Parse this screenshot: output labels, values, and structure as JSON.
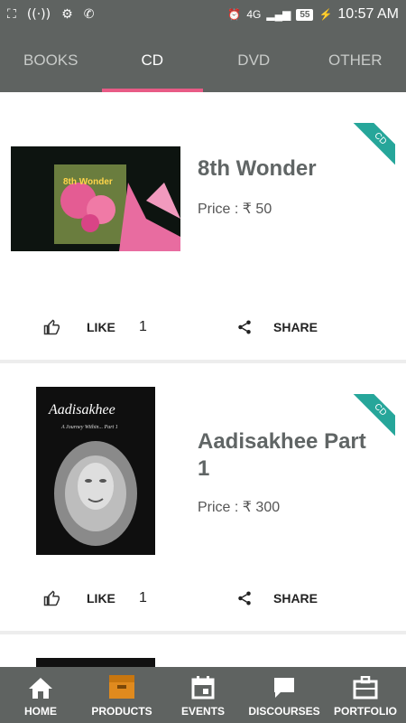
{
  "status_bar": {
    "time": "10:57 AM",
    "battery": "55",
    "network": "4G"
  },
  "tabs": [
    {
      "label": "BOOKS"
    },
    {
      "label": "CD"
    },
    {
      "label": "DVD"
    },
    {
      "label": "OTHER"
    }
  ],
  "active_tab": "CD",
  "items": [
    {
      "title": "8th Wonder",
      "price": "Price : ₹ 50",
      "badge": "CD",
      "like_label": "LIKE",
      "like_count": "1",
      "share_label": "SHARE",
      "cover_title": "8th Wonder"
    },
    {
      "title": "Aadisakhee Part 1",
      "price": "Price : ₹ 300",
      "badge": "CD",
      "like_label": "LIKE",
      "like_count": "1",
      "share_label": "SHARE",
      "cover_title": "Aadisakhee",
      "cover_subtitle": "A Journey Within... Part 1"
    }
  ],
  "bottom_nav": [
    {
      "label": "HOME"
    },
    {
      "label": "PRODUCTS"
    },
    {
      "label": "EVENTS"
    },
    {
      "label": "DISCOURSES"
    },
    {
      "label": "PORTFOLIO"
    }
  ],
  "colors": {
    "bar": "#5f6361",
    "accent": "#e85b86",
    "ribbon": "#26a69a",
    "active_nav": "#e08a1e"
  }
}
